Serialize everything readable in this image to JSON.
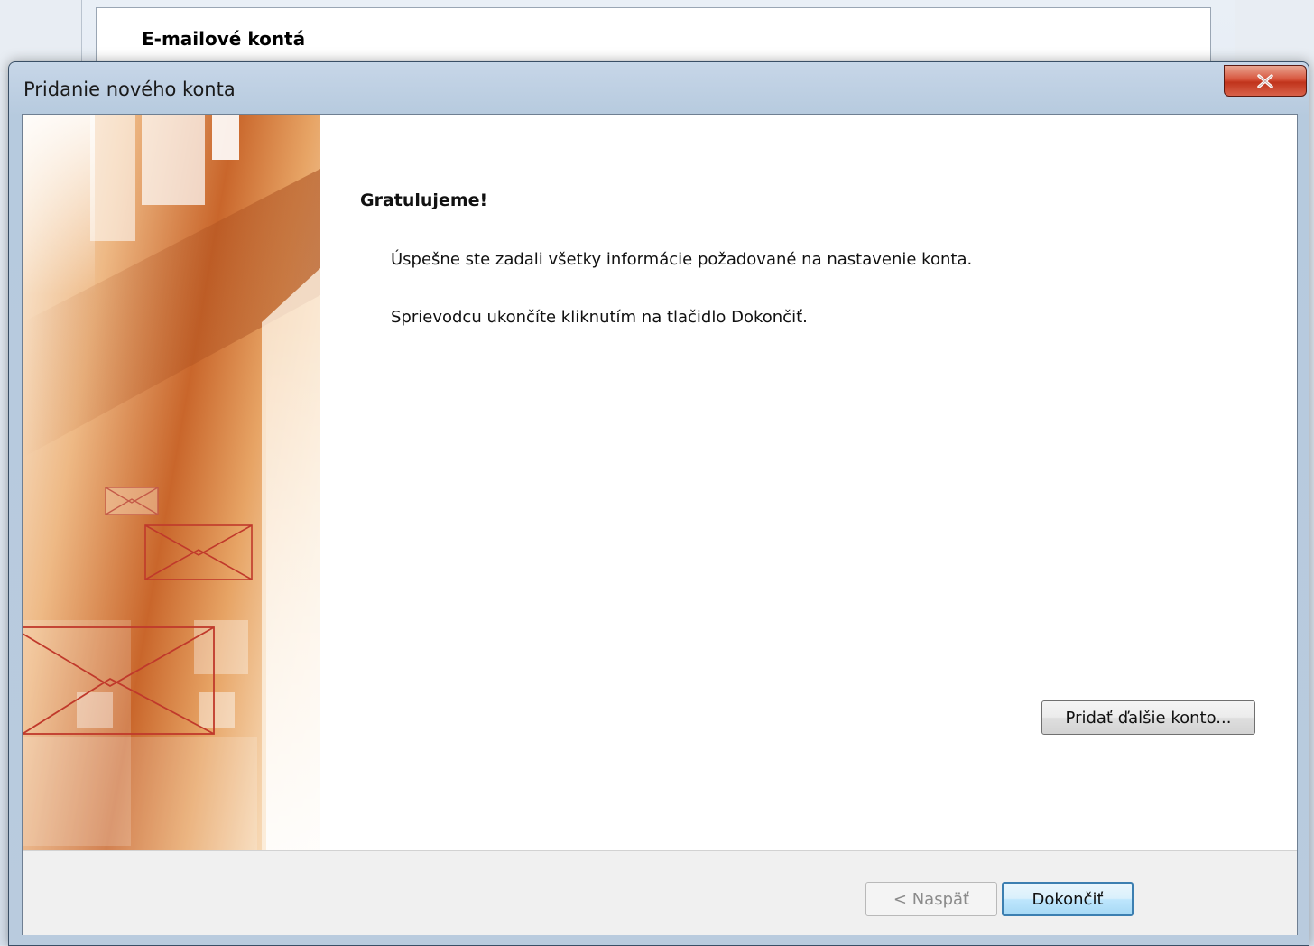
{
  "background_window": {
    "title": "E-mailové kontá"
  },
  "dialog": {
    "title": "Pridanie nového konta",
    "close_label": "x",
    "heading": "Gratulujeme!",
    "message_1": "Úspešne ste zadali všetky informácie požadované na nastavenie konta.",
    "message_2": "Sprievodcu ukončíte kliknutím na tlačidlo Dokončiť.",
    "add_account_button": "Pridať ďalšie konto...",
    "back_button": "< Naspäť",
    "finish_button": "Dokončiť"
  },
  "icons": [
    "close-icon",
    "envelope-icon"
  ],
  "colors": {
    "accent_finish_border": "#3c7fb1",
    "close_red": "#c0341c",
    "banner_orange": "#c9662b"
  }
}
